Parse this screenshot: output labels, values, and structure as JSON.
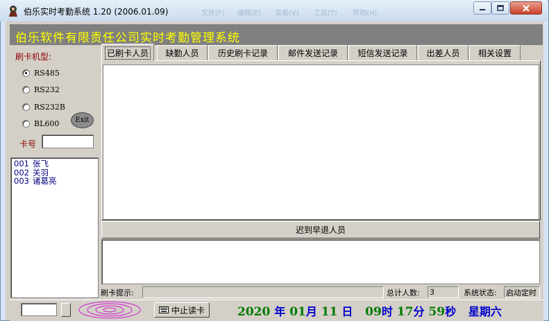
{
  "window": {
    "title": "伯乐实时考勤系统 1.20 (2006.01.09)",
    "ghost_menu": [
      "文件(F)",
      "编辑(E)",
      "查看(V)",
      "工具(T)",
      "帮助(H)"
    ]
  },
  "banner": {
    "title": "伯乐软件有限责任公司实时考勤管理系统"
  },
  "reader": {
    "label": "刷卡机型:",
    "options": [
      {
        "label": "RS485",
        "checked": true
      },
      {
        "label": "RS232",
        "checked": false
      },
      {
        "label": "RS232B",
        "checked": false
      },
      {
        "label": "BL600",
        "checked": false
      }
    ],
    "exit_label": "Exit",
    "card_label": "卡号",
    "card_value": ""
  },
  "people": [
    {
      "id": "001",
      "name": "张飞"
    },
    {
      "id": "002",
      "name": "关羽"
    },
    {
      "id": "003",
      "name": "诸葛亮"
    }
  ],
  "tabs": [
    {
      "label": "已刷卡人员",
      "active": true
    },
    {
      "label": "缺勤人员",
      "active": false
    },
    {
      "label": "历史刷卡记录",
      "active": false
    },
    {
      "label": "邮件发送记录",
      "active": false
    },
    {
      "label": "短信发送记录",
      "active": false
    },
    {
      "label": "出差人员",
      "active": false
    },
    {
      "label": "相关设置",
      "active": false
    }
  ],
  "late_early": {
    "label": "迟到早退人员"
  },
  "status": {
    "hint_label": "刷卡提示:",
    "hint_value": "",
    "total_label": "总计人数:",
    "total_value": "3",
    "system_label": "系统状态:",
    "system_value": "启动定时"
  },
  "bottom": {
    "stop_label": "中止读卡"
  },
  "clock": {
    "year": "2020",
    "year_unit": "年",
    "month": "01",
    "month_unit": "月",
    "day": "11",
    "day_unit": "日",
    "hour": "09",
    "hour_unit": "时",
    "minute": "17",
    "minute_unit": "分",
    "second": "59",
    "second_unit": "秒",
    "weekday_label": "星期",
    "weekday": "六"
  },
  "colors": {
    "banner_text": "#ffff00",
    "banner_bg": "#808080",
    "label_red": "#8b0000",
    "list_blue": "#000080",
    "clock_green": "#007a00",
    "clock_unit_blue": "#0000cc"
  }
}
